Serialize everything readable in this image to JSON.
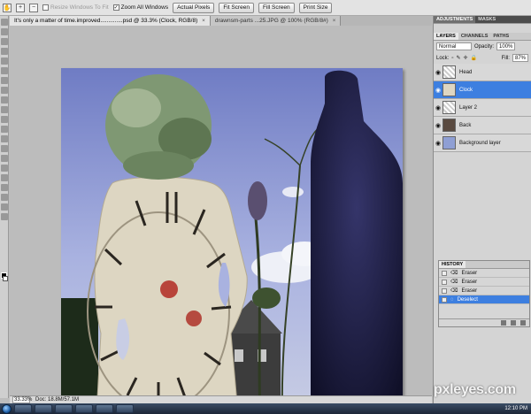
{
  "options_bar": {
    "resize_windows": "Resize Windows To Fit",
    "zoom_all_windows": "Zoom All Windows",
    "actual_pixels": "Actual Pixels",
    "fit_screen": "Fit Screen",
    "fill_screen": "Fill Screen",
    "print_size": "Print Size"
  },
  "document_tabs": [
    {
      "label": "It's only a matter of time.improved..............psd @ 33.3% (Clock, RGB/8)",
      "close": "×"
    },
    {
      "label": "drawnsm-parts ...25.JPG @ 100% (RGB/8#)",
      "close": "×"
    }
  ],
  "status_bar": {
    "zoom": "33.33%",
    "doc": "Doc: 18.8M/57.1M"
  },
  "adjustments_panel": {
    "tabs": [
      "ADJUSTMENTS",
      "MASKS"
    ]
  },
  "layers_panel": {
    "tabs": [
      "LAYERS",
      "CHANNELS",
      "PATHS"
    ],
    "blend_mode": "Normal",
    "opacity_label": "Opacity:",
    "opacity_value": "100%",
    "lock_label": "Lock:",
    "fill_label": "Fill:",
    "fill_value": "87%",
    "layers": [
      {
        "name": "Head"
      },
      {
        "name": "Clock"
      },
      {
        "name": "Layer 2"
      },
      {
        "name": "Back"
      },
      {
        "name": "Background layer"
      }
    ]
  },
  "history_panel": {
    "title": "HISTORY",
    "items": [
      {
        "label": "Eraser"
      },
      {
        "label": "Eraser"
      },
      {
        "label": "Eraser"
      },
      {
        "label": "Deselect"
      }
    ]
  },
  "taskbar": {
    "clock": "12:10 PM"
  },
  "watermark": "pxleyes.com",
  "colors": {
    "selection": "#3d7fe0",
    "sky": "#8f9fd4",
    "clock_face": "#ddd6c2",
    "foliage": "#8aa07a",
    "statue": "#25254a"
  }
}
